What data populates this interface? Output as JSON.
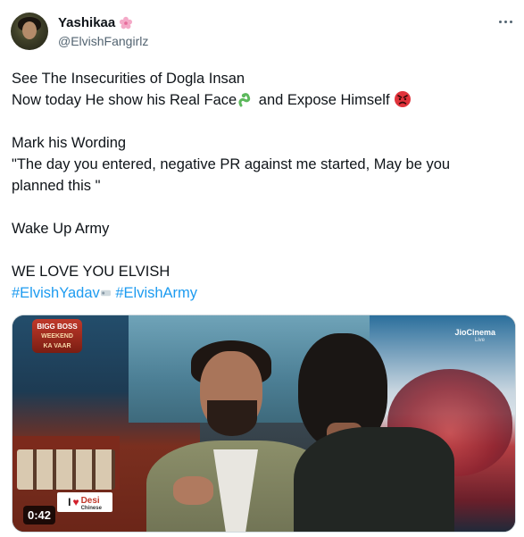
{
  "author": {
    "display_name": "Yashikaa",
    "name_emoji": "cherry-blossom-icon",
    "handle": "@ElvishFangirlz"
  },
  "more_button_label": "More",
  "tweet": {
    "line1": "See The Insecurities of Dogla Insan",
    "line2_part1": "Now today He show his Real Face",
    "line2_part2": " and Expose Himself ",
    "line3": "Mark his Wording",
    "line4": "\"The day you entered, negative PR against me started, May be you",
    "line5": "planned this \"",
    "line6": "Wake Up Army",
    "line7": "WE LOVE YOU ELVISH",
    "hashtag1": "#ElvishYadav",
    "hashtag2": "#ElvishArmy"
  },
  "emojis": {
    "face_emoji": "snake-icon",
    "angry_emoji": "angry-face-icon",
    "hashtag_emoji": "hashflag-icon"
  },
  "media": {
    "brand_line1": "BIGG BOSS",
    "brand_line2": "WEEKEND",
    "brand_line3": "KA VAAR",
    "channel": "JioCinema",
    "channel_sub": "Live",
    "sign_i": "I",
    "sign_desi": "Desi",
    "sign_chinese": "Chinese",
    "duration": "0:42"
  },
  "colors": {
    "link": "#1d9bf0",
    "text": "#0f1419",
    "secondary": "#536471"
  }
}
